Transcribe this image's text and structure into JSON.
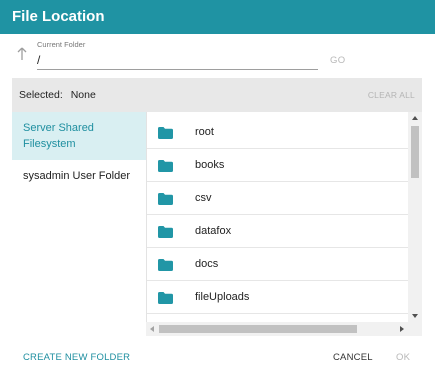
{
  "dialog": {
    "title": "File Location"
  },
  "folder": {
    "label": "Current Folder",
    "value": "/",
    "go_label": "GO"
  },
  "selection": {
    "label": "Selected:",
    "value": "None",
    "clear_label": "CLEAR ALL"
  },
  "sources": [
    {
      "label": "Server Shared Filesystem",
      "active": true
    },
    {
      "label": "sysadmin User Folder",
      "active": false
    }
  ],
  "files": [
    {
      "name": "root",
      "icon": "folder-icon"
    },
    {
      "name": "books",
      "icon": "folder-icon"
    },
    {
      "name": "csv",
      "icon": "folder-icon"
    },
    {
      "name": "datafox",
      "icon": "folder-icon"
    },
    {
      "name": "docs",
      "icon": "folder-icon"
    },
    {
      "name": "fileUploads",
      "icon": "folder-icon"
    }
  ],
  "footer": {
    "create_label": "CREATE NEW FOLDER",
    "cancel_label": "CANCEL",
    "ok_label": "OK"
  },
  "colors": {
    "accent": "#1f93a3",
    "folder": "#2196a6",
    "active_bg": "#d9eff2"
  }
}
